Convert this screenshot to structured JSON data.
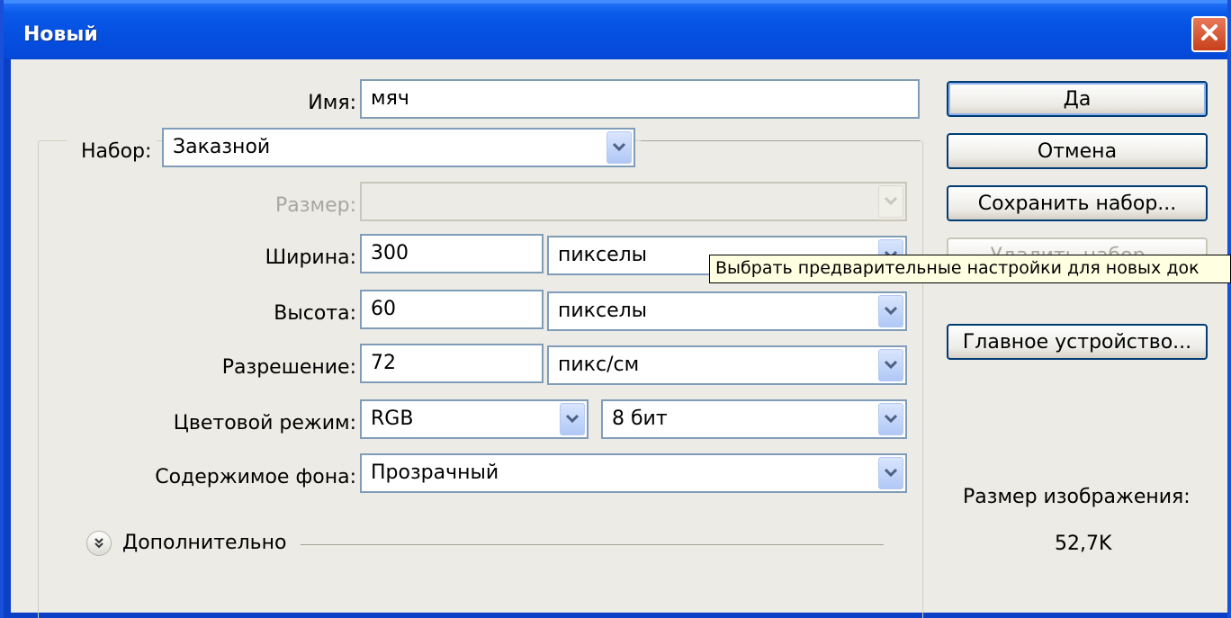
{
  "window": {
    "title": "Новый"
  },
  "form": {
    "name_label": "Имя:",
    "name_value": "мяч",
    "preset_label": "Набор:",
    "preset_value": "Заказной",
    "size_label": "Размер:",
    "size_value": "",
    "width_label": "Ширина:",
    "width_value": "300",
    "width_unit": "пикселы",
    "height_label": "Высота:",
    "height_value": "60",
    "height_unit": "пикселы",
    "resolution_label": "Разрешение:",
    "resolution_value": "72",
    "resolution_unit": "пикс/см",
    "color_mode_label": "Цветовой режим:",
    "color_mode_value": "RGB",
    "bit_depth_value": "8 бит",
    "background_label": "Содержимое фона:",
    "background_value": "Прозрачный",
    "advanced_label": "Дополнительно"
  },
  "buttons": {
    "ok": "Да",
    "cancel": "Отмена",
    "save_preset": "Сохранить набор...",
    "delete_preset": "Удалить набор...",
    "device_central": "Главное устройство..."
  },
  "tooltip": {
    "text": "Выбрать предварительные настройки для новых док"
  },
  "image_size": {
    "label": "Размер изображения:",
    "value": "52,7K"
  },
  "colors": {
    "titlebar": "#0550e0",
    "dialog_bg": "#ecebe5",
    "accent_border": "#7f9db9",
    "close": "#c8401a"
  },
  "icons": {
    "close": "close-icon",
    "dropdown": "chevron-down-icon",
    "expand": "double-chevron-down-icon"
  }
}
